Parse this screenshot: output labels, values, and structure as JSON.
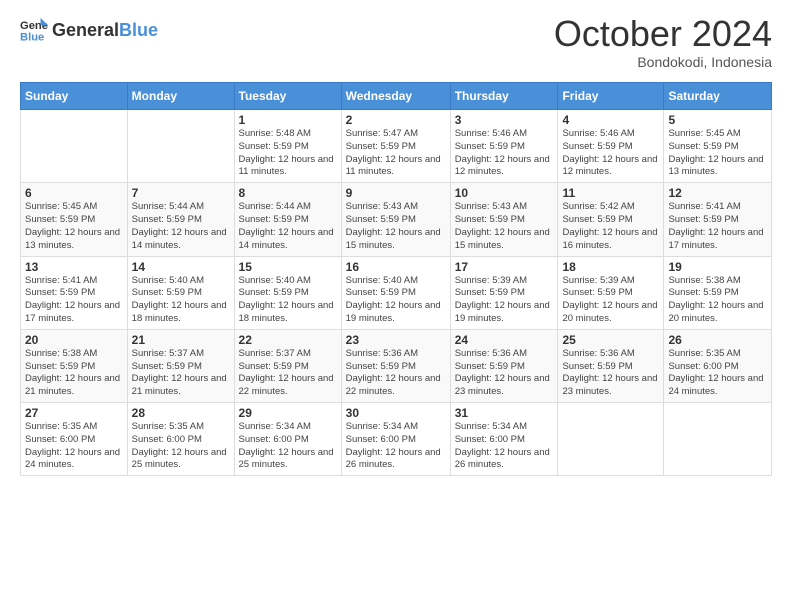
{
  "header": {
    "logo_general": "General",
    "logo_blue": "Blue",
    "month_title": "October 2024",
    "location": "Bondokodi, Indonesia"
  },
  "days_of_week": [
    "Sunday",
    "Monday",
    "Tuesday",
    "Wednesday",
    "Thursday",
    "Friday",
    "Saturday"
  ],
  "weeks": [
    [
      {
        "day": "",
        "info": ""
      },
      {
        "day": "",
        "info": ""
      },
      {
        "day": "1",
        "info": "Sunrise: 5:48 AM\nSunset: 5:59 PM\nDaylight: 12 hours and 11 minutes."
      },
      {
        "day": "2",
        "info": "Sunrise: 5:47 AM\nSunset: 5:59 PM\nDaylight: 12 hours and 11 minutes."
      },
      {
        "day": "3",
        "info": "Sunrise: 5:46 AM\nSunset: 5:59 PM\nDaylight: 12 hours and 12 minutes."
      },
      {
        "day": "4",
        "info": "Sunrise: 5:46 AM\nSunset: 5:59 PM\nDaylight: 12 hours and 12 minutes."
      },
      {
        "day": "5",
        "info": "Sunrise: 5:45 AM\nSunset: 5:59 PM\nDaylight: 12 hours and 13 minutes."
      }
    ],
    [
      {
        "day": "6",
        "info": "Sunrise: 5:45 AM\nSunset: 5:59 PM\nDaylight: 12 hours and 13 minutes."
      },
      {
        "day": "7",
        "info": "Sunrise: 5:44 AM\nSunset: 5:59 PM\nDaylight: 12 hours and 14 minutes."
      },
      {
        "day": "8",
        "info": "Sunrise: 5:44 AM\nSunset: 5:59 PM\nDaylight: 12 hours and 14 minutes."
      },
      {
        "day": "9",
        "info": "Sunrise: 5:43 AM\nSunset: 5:59 PM\nDaylight: 12 hours and 15 minutes."
      },
      {
        "day": "10",
        "info": "Sunrise: 5:43 AM\nSunset: 5:59 PM\nDaylight: 12 hours and 15 minutes."
      },
      {
        "day": "11",
        "info": "Sunrise: 5:42 AM\nSunset: 5:59 PM\nDaylight: 12 hours and 16 minutes."
      },
      {
        "day": "12",
        "info": "Sunrise: 5:41 AM\nSunset: 5:59 PM\nDaylight: 12 hours and 17 minutes."
      }
    ],
    [
      {
        "day": "13",
        "info": "Sunrise: 5:41 AM\nSunset: 5:59 PM\nDaylight: 12 hours and 17 minutes."
      },
      {
        "day": "14",
        "info": "Sunrise: 5:40 AM\nSunset: 5:59 PM\nDaylight: 12 hours and 18 minutes."
      },
      {
        "day": "15",
        "info": "Sunrise: 5:40 AM\nSunset: 5:59 PM\nDaylight: 12 hours and 18 minutes."
      },
      {
        "day": "16",
        "info": "Sunrise: 5:40 AM\nSunset: 5:59 PM\nDaylight: 12 hours and 19 minutes."
      },
      {
        "day": "17",
        "info": "Sunrise: 5:39 AM\nSunset: 5:59 PM\nDaylight: 12 hours and 19 minutes."
      },
      {
        "day": "18",
        "info": "Sunrise: 5:39 AM\nSunset: 5:59 PM\nDaylight: 12 hours and 20 minutes."
      },
      {
        "day": "19",
        "info": "Sunrise: 5:38 AM\nSunset: 5:59 PM\nDaylight: 12 hours and 20 minutes."
      }
    ],
    [
      {
        "day": "20",
        "info": "Sunrise: 5:38 AM\nSunset: 5:59 PM\nDaylight: 12 hours and 21 minutes."
      },
      {
        "day": "21",
        "info": "Sunrise: 5:37 AM\nSunset: 5:59 PM\nDaylight: 12 hours and 21 minutes."
      },
      {
        "day": "22",
        "info": "Sunrise: 5:37 AM\nSunset: 5:59 PM\nDaylight: 12 hours and 22 minutes."
      },
      {
        "day": "23",
        "info": "Sunrise: 5:36 AM\nSunset: 5:59 PM\nDaylight: 12 hours and 22 minutes."
      },
      {
        "day": "24",
        "info": "Sunrise: 5:36 AM\nSunset: 5:59 PM\nDaylight: 12 hours and 23 minutes."
      },
      {
        "day": "25",
        "info": "Sunrise: 5:36 AM\nSunset: 5:59 PM\nDaylight: 12 hours and 23 minutes."
      },
      {
        "day": "26",
        "info": "Sunrise: 5:35 AM\nSunset: 6:00 PM\nDaylight: 12 hours and 24 minutes."
      }
    ],
    [
      {
        "day": "27",
        "info": "Sunrise: 5:35 AM\nSunset: 6:00 PM\nDaylight: 12 hours and 24 minutes."
      },
      {
        "day": "28",
        "info": "Sunrise: 5:35 AM\nSunset: 6:00 PM\nDaylight: 12 hours and 25 minutes."
      },
      {
        "day": "29",
        "info": "Sunrise: 5:34 AM\nSunset: 6:00 PM\nDaylight: 12 hours and 25 minutes."
      },
      {
        "day": "30",
        "info": "Sunrise: 5:34 AM\nSunset: 6:00 PM\nDaylight: 12 hours and 26 minutes."
      },
      {
        "day": "31",
        "info": "Sunrise: 5:34 AM\nSunset: 6:00 PM\nDaylight: 12 hours and 26 minutes."
      },
      {
        "day": "",
        "info": ""
      },
      {
        "day": "",
        "info": ""
      }
    ]
  ]
}
